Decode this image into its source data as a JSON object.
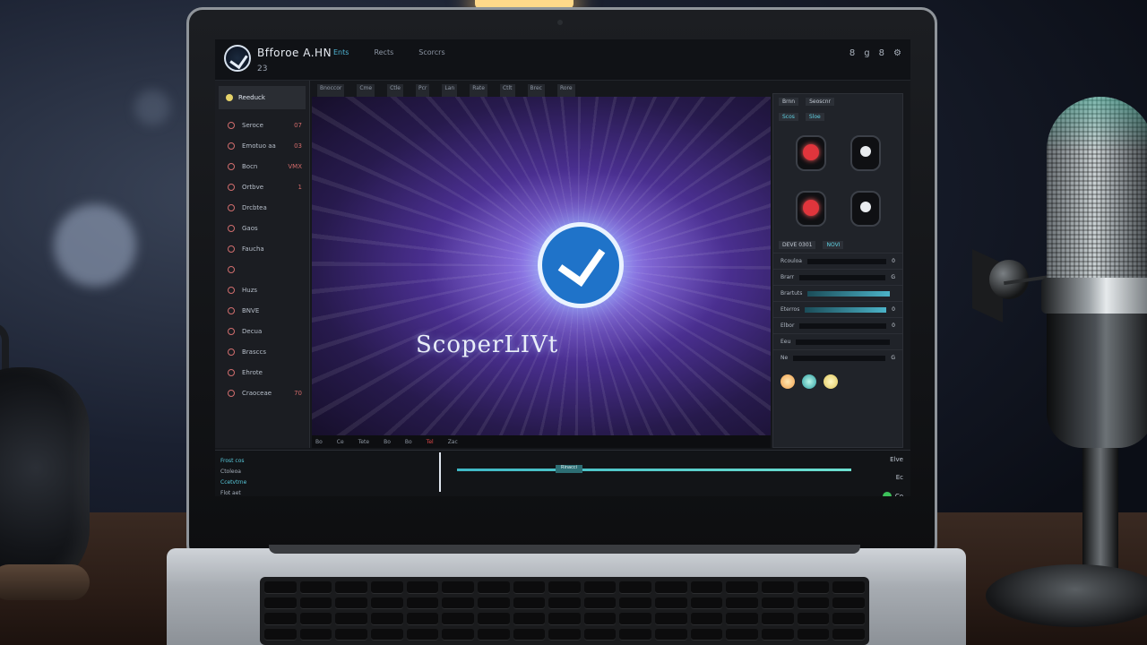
{
  "app": {
    "title": "Bfforoe A.HN",
    "subtitle": "23",
    "menu": [
      "Ents",
      "Rects",
      "Scorcrs"
    ],
    "window_controls": [
      "8",
      "g",
      "8",
      "⚙"
    ]
  },
  "sidebar": {
    "header": "Reeduck",
    "items": [
      {
        "label": "Seroce",
        "right": "07"
      },
      {
        "label": "Emotuo aa",
        "right": "03"
      },
      {
        "label": "Bocn",
        "right": "VMX"
      },
      {
        "label": "Ortbve",
        "right": "1"
      },
      {
        "label": "Drcbtea",
        "right": ""
      },
      {
        "label": "Gaos",
        "right": ""
      },
      {
        "label": "Faucha",
        "right": ""
      },
      {
        "label": "",
        "right": ""
      },
      {
        "label": "Huzs",
        "right": ""
      },
      {
        "label": "BNVE",
        "right": ""
      },
      {
        "label": "Decua",
        "right": ""
      },
      {
        "label": "Brasccs",
        "right": ""
      },
      {
        "label": "Ehrote",
        "right": ""
      },
      {
        "label": "Craoceae",
        "right": "70"
      }
    ]
  },
  "toolstrip": [
    "Bnoccor",
    "Cme",
    "Ctle",
    "Pcr",
    "Lan",
    "Rate",
    "Ctlt",
    "Brec",
    "Rore"
  ],
  "preview": {
    "title": "ScoperLIVt",
    "strip": [
      "Bo",
      "Ce",
      "Tete",
      "Bo",
      "Bo",
      "Tel",
      "Zac"
    ]
  },
  "effects_panel": {
    "tabs": [
      "Brnn",
      "Seoscnr"
    ],
    "subtabs": [
      "Scos",
      "Sloe"
    ],
    "icons": [
      "red-record",
      "white-record",
      "red-record",
      "white-record"
    ],
    "labels": [
      "DEVE 0301",
      "NOVI"
    ],
    "rows": [
      {
        "label": "Rcouloa",
        "value": "0"
      },
      {
        "label": "Brarr",
        "value": "G"
      },
      {
        "label": "Brartuts",
        "value": ""
      },
      {
        "label": "Eterros",
        "value": "0"
      },
      {
        "label": "Elbor",
        "value": "0"
      },
      {
        "label": "Eeu",
        "value": ""
      },
      {
        "label": "Ne",
        "value": "G"
      }
    ]
  },
  "timeline": {
    "tracks": [
      "Frost cos",
      "Ctoleoa",
      "Ccetvtrne",
      "Flot aet"
    ],
    "clip": "Rinacci",
    "right": [
      "Elve",
      "Ec",
      "Co"
    ]
  },
  "colors": {
    "accent": "#4fb6d6",
    "record_red": "#e0353c",
    "preview_glow": "#8a6fe0"
  }
}
